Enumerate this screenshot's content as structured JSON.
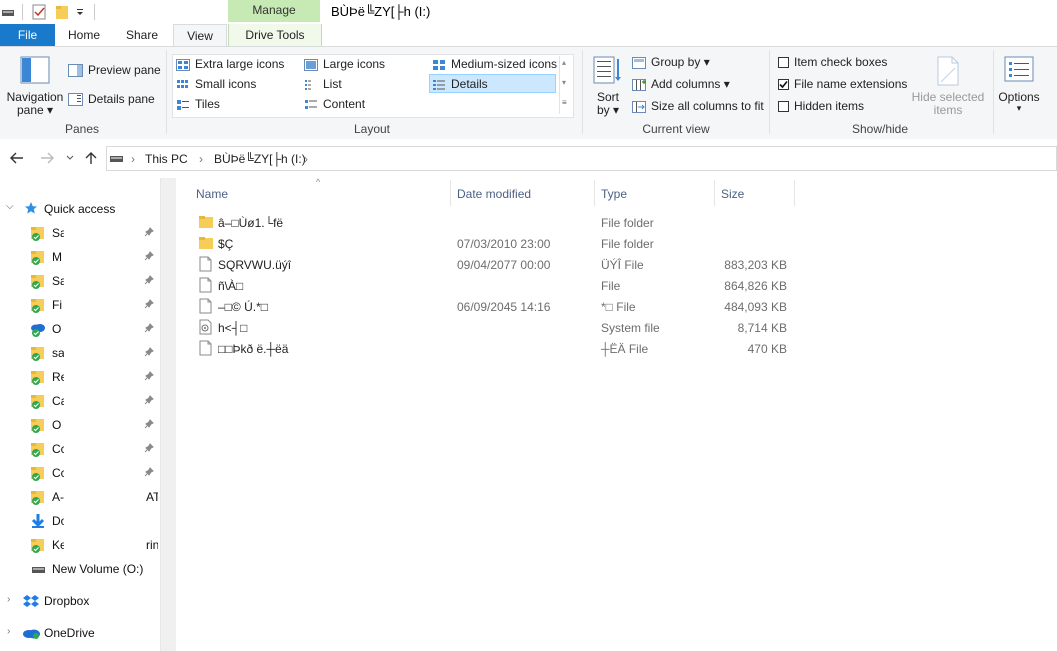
{
  "titlebar": {
    "manage_tab": "Manage",
    "window_title": "BÙÞë╚ZY[├h (I:)"
  },
  "tabs": [
    "File",
    "Home",
    "Share",
    "View",
    "Drive Tools"
  ],
  "ribbon": {
    "panes": {
      "label": "Panes",
      "navigation_pane_l1": "Navigation",
      "navigation_pane_l2": "pane",
      "preview_pane": "Preview pane",
      "details_pane": "Details pane"
    },
    "layout": {
      "label": "Layout",
      "extra_large_icons": "Extra large icons",
      "large_icons": "Large icons",
      "medium_icons": "Medium-sized icons",
      "small_icons": "Small icons",
      "list": "List",
      "details": "Details",
      "tiles": "Tiles",
      "content": "Content"
    },
    "current_view": {
      "label": "Current view",
      "sort_l1": "Sort",
      "sort_l2": "by",
      "group_by": "Group by",
      "add_columns": "Add columns",
      "size_all_columns": "Size all columns to fit"
    },
    "show_hide": {
      "label": "Show/hide",
      "item_check_boxes": "Item check boxes",
      "item_check_boxes_checked": false,
      "file_name_extensions": "File name extensions",
      "file_name_extensions_checked": true,
      "hidden_items": "Hidden items",
      "hidden_items_checked": false,
      "hide_selected_l1": "Hide selected",
      "hide_selected_l2": "items"
    },
    "options": {
      "label": "Options"
    }
  },
  "address": {
    "crumbs": [
      "This PC",
      "BÙÞë╚ZY[├h (I:)"
    ]
  },
  "navpane": {
    "quick_access": "Quick access",
    "qa_items": [
      {
        "label": "Sa",
        "icon": "folder-sync"
      },
      {
        "label": "M",
        "icon": "folder-sync"
      },
      {
        "label": "Sa",
        "icon": "folder-sync"
      },
      {
        "label": "Fi",
        "icon": "folder-sync"
      },
      {
        "label": "O",
        "icon": "onedrive"
      },
      {
        "label": "sa",
        "icon": "folder-sync"
      },
      {
        "label": "Re",
        "icon": "folder-sync"
      },
      {
        "label": "Ca",
        "icon": "folder-sync"
      },
      {
        "label": "O",
        "icon": "folder-sync"
      },
      {
        "label": "Cc",
        "icon": "folder-sync"
      },
      {
        "label": "Cc",
        "icon": "folder-sync"
      },
      {
        "label": "A-",
        "icon": "folder-sync",
        "extra": "AT"
      },
      {
        "label": "Do",
        "icon": "download"
      },
      {
        "label": "Ke",
        "icon": "folder-sync",
        "extra": "rin"
      }
    ],
    "new_volume": "New Volume (O:)",
    "dropbox": "Dropbox",
    "onedrive": "OneDrive"
  },
  "columns": [
    "Name",
    "Date modified",
    "Type",
    "Size"
  ],
  "files": [
    {
      "name": "â–□Ùø1.└fë",
      "date": "",
      "type": "File folder",
      "size": "",
      "icon": "folder"
    },
    {
      "name": "$Ç",
      "date": "07/03/2010 23:00",
      "type": "File folder",
      "size": "",
      "icon": "folder"
    },
    {
      "name": "SQRVWU.üýî",
      "date": "09/04/2077 00:00",
      "type": "ÜÝÎ File",
      "size": "883,203 KB",
      "icon": "file"
    },
    {
      "name": "ñ\\À□",
      "date": "",
      "type": "File",
      "size": "864,826 KB",
      "icon": "file"
    },
    {
      "name": "–□©   Ú.*□",
      "date": "06/09/2045 14:16",
      "type": "*□ File",
      "size": "484,093 KB",
      "icon": "file"
    },
    {
      "name": "h<┤□",
      "date": "",
      "type": "System file",
      "size": "8,714 KB",
      "icon": "sysfile"
    },
    {
      "name": "□□Þkð  ë.┼ëä",
      "date": "",
      "type": "┼ËÄ File",
      "size": "470 KB",
      "icon": "file"
    }
  ]
}
